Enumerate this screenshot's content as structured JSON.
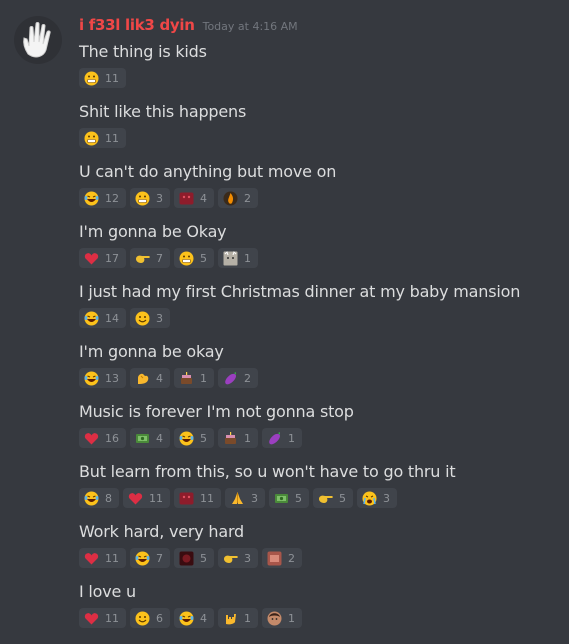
{
  "author": {
    "name": "i f33l lik3 dyin",
    "timestamp": "Today at 4:16 AM"
  },
  "messages": [
    {
      "text": "The thing is kids",
      "reactions": [
        {
          "emoji": "grimace-face",
          "count": "11"
        }
      ]
    },
    {
      "text": "Shit like this happens",
      "reactions": [
        {
          "emoji": "grimace-face",
          "count": "11"
        }
      ]
    },
    {
      "text": "U can't do anything but move on",
      "reactions": [
        {
          "emoji": "laughing-face",
          "count": "12"
        },
        {
          "emoji": "grimace-face",
          "count": "3"
        },
        {
          "emoji": "red-emote",
          "count": "4"
        },
        {
          "emoji": "fire-emote",
          "count": "2"
        }
      ]
    },
    {
      "text": "I'm gonna be Okay",
      "reactions": [
        {
          "emoji": "heart",
          "count": "17"
        },
        {
          "emoji": "pointing-emote",
          "count": "7"
        },
        {
          "emoji": "grimace-face",
          "count": "5"
        },
        {
          "emoji": "cat-emote",
          "count": "1"
        }
      ]
    },
    {
      "text": "I just had my first Christmas dinner at my baby mansion",
      "reactions": [
        {
          "emoji": "laughing-face",
          "count": "14"
        },
        {
          "emoji": "smile-face",
          "count": "3"
        }
      ]
    },
    {
      "text": "I'm gonna be okay",
      "reactions": [
        {
          "emoji": "laughing-face",
          "count": "13"
        },
        {
          "emoji": "flexed-biceps",
          "count": "4"
        },
        {
          "emoji": "cake-emote",
          "count": "1"
        },
        {
          "emoji": "eggplant",
          "count": "2"
        }
      ]
    },
    {
      "text": "Music is forever I'm not gonna stop",
      "reactions": [
        {
          "emoji": "heart",
          "count": "16"
        },
        {
          "emoji": "money-emote",
          "count": "4"
        },
        {
          "emoji": "laughing-face",
          "count": "5"
        },
        {
          "emoji": "cake-emote",
          "count": "1"
        },
        {
          "emoji": "eggplant",
          "count": "1"
        }
      ]
    },
    {
      "text": "But learn from this, so u won't have to go thru it",
      "reactions": [
        {
          "emoji": "laughing-face",
          "count": "8"
        },
        {
          "emoji": "heart",
          "count": "11"
        },
        {
          "emoji": "red-emote",
          "count": "11"
        },
        {
          "emoji": "praying-hands",
          "count": "3"
        },
        {
          "emoji": "money-emote",
          "count": "5"
        },
        {
          "emoji": "pointing-emote",
          "count": "5"
        },
        {
          "emoji": "crying-face",
          "count": "3"
        }
      ]
    },
    {
      "text": "Work hard, very hard",
      "reactions": [
        {
          "emoji": "heart",
          "count": "11"
        },
        {
          "emoji": "laughing-face",
          "count": "7"
        },
        {
          "emoji": "dark-emote",
          "count": "5"
        },
        {
          "emoji": "pointing-emote",
          "count": "3"
        },
        {
          "emoji": "brown-emote",
          "count": "2"
        }
      ]
    },
    {
      "text": "I love u",
      "reactions": [
        {
          "emoji": "heart",
          "count": "11"
        },
        {
          "emoji": "smile-face",
          "count": "6"
        },
        {
          "emoji": "laughing-face",
          "count": "4"
        },
        {
          "emoji": "rock-hand",
          "count": "1"
        },
        {
          "emoji": "face-emote",
          "count": "1"
        }
      ]
    }
  ]
}
